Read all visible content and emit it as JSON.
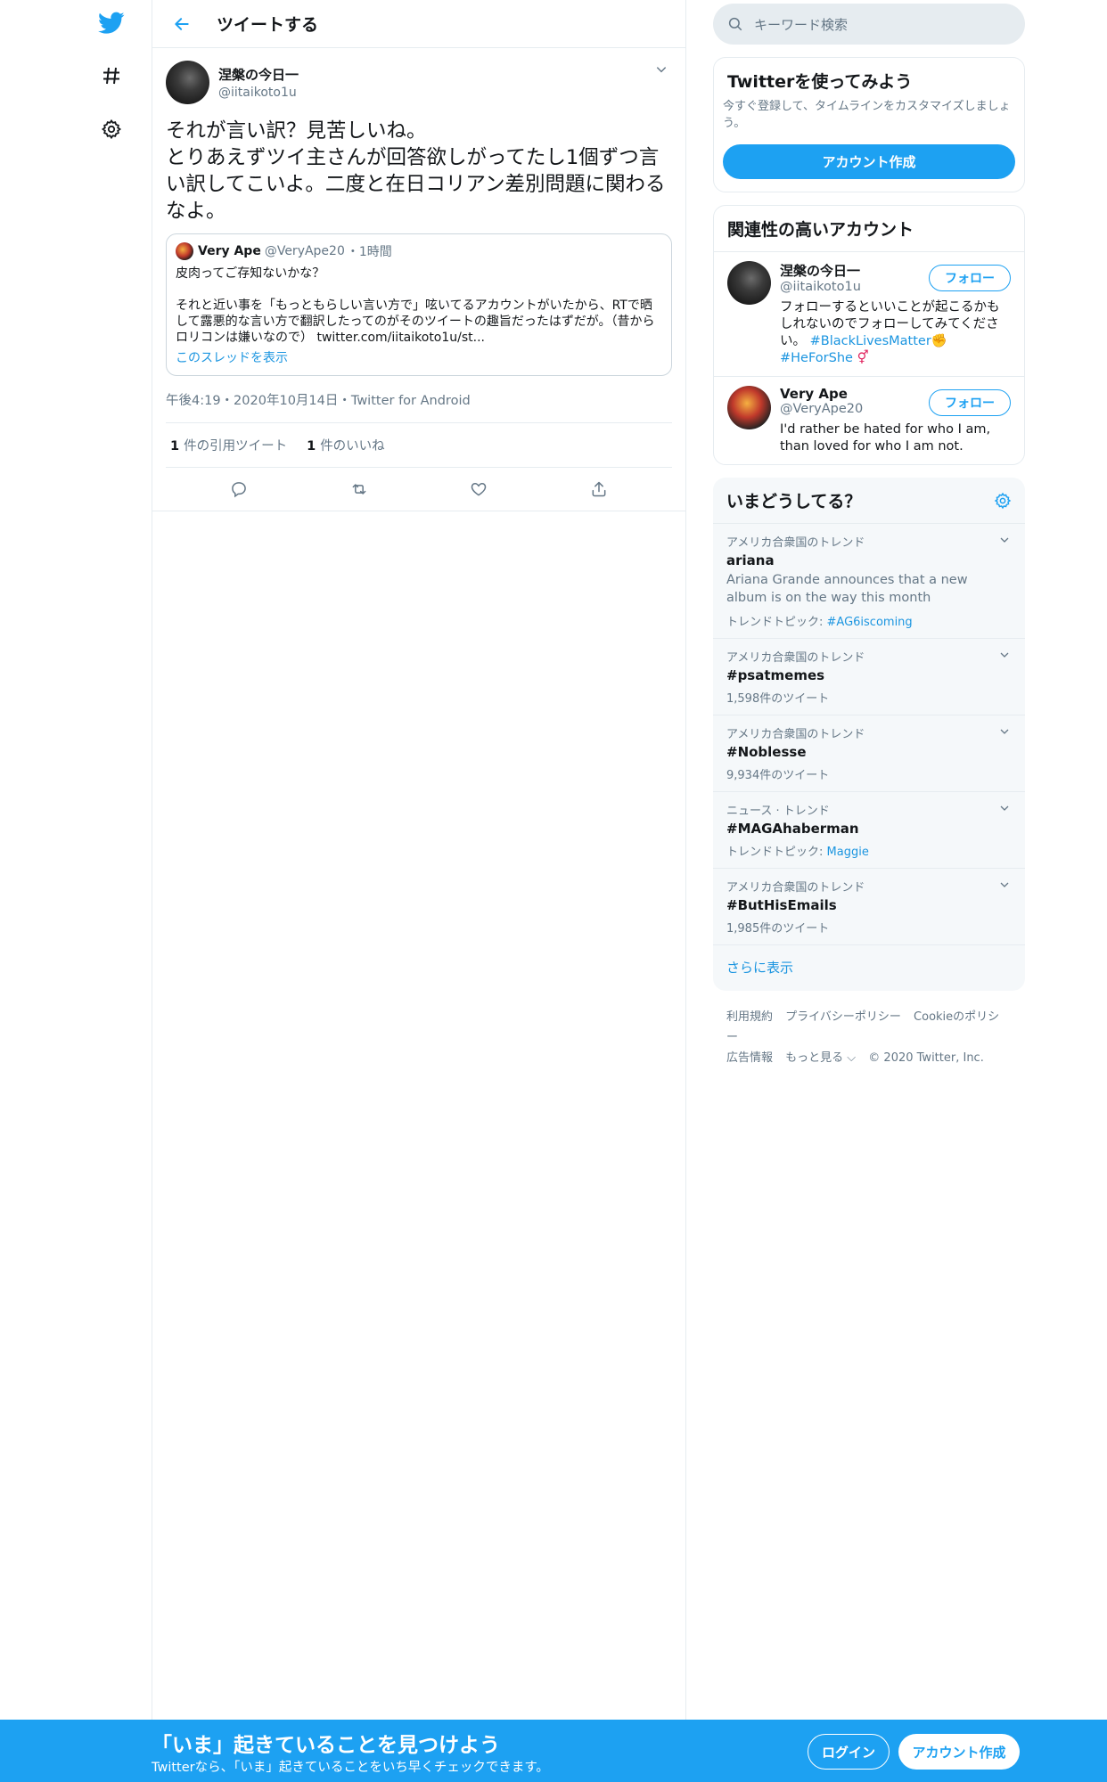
{
  "nav": {
    "icons": [
      "twitter-bird-icon",
      "hashtag-icon",
      "gear-icon"
    ]
  },
  "header": {
    "title": "ツイートする"
  },
  "tweet": {
    "author_name": "涅槃の今日一",
    "author_handle": "@iitaikoto1u",
    "text": "それが言い訳？見苦しいね。\nとりあえずツイ主さんが回答欲しがってたし1個ずつ言い訳してこいよ。二度と在日コリアン差別問題に関わるなよ。",
    "quote": {
      "name": "Very Ape",
      "handle": "@VeryApe20",
      "time": "・1時間",
      "text": "皮肉ってご存知ないかな？\n\nそれと近い事を「もっともらしい言い方で」呟いてるアカウントがいたから、RTで晒して露悪的な言い方で翻訳したってのがそのツイートの趣旨だったはずだが。（昔からロリコンは嫌いなので） twitter.com/iitaikoto1u/st...",
      "thread_link": "このスレッドを表示"
    },
    "meta": "午後4:19・2020年10月14日・Twitter for Android",
    "quote_count": "1",
    "quote_label": "件の引用ツイート",
    "like_count": "1",
    "like_label": "件のいいね"
  },
  "search": {
    "placeholder": "キーワード検索"
  },
  "signup_card": {
    "title": "Twitterを使ってみよう",
    "desc": "今すぐ登録して、タイムラインをカスタマイズしましょう。",
    "button": "アカウント作成"
  },
  "related": {
    "title": "関連性の高いアカウント",
    "follow_label": "フォロー",
    "accounts": [
      {
        "name": "涅槃の今日一",
        "handle": "@iitaikoto1u",
        "bio": "フォローするといいことが起こるかもしれないのでフォローしてみてください。",
        "tag1": "#BlackLivesMatter",
        "tag2": "#HeForShe"
      },
      {
        "name": "Very Ape",
        "handle": "@VeryApe20",
        "bio": "I'd rather be hated for who I am, than loved for who I am not."
      }
    ]
  },
  "trends": {
    "title": "いまどうしてる？",
    "items": [
      {
        "context": "アメリカ合衆国のトレンド",
        "name": "ariana",
        "desc": "Ariana Grande announces that a new album is on the way this month",
        "sub_label": "トレンドトピック: ",
        "sub_link": "#AG6iscoming"
      },
      {
        "context": "アメリカ合衆国のトレンド",
        "name": "#psatmemes",
        "count": "1,598件のツイート"
      },
      {
        "context": "アメリカ合衆国のトレンド",
        "name": "#Noblesse",
        "count": "9,934件のツイート"
      },
      {
        "context": "ニュース · トレンド",
        "name": "#MAGAhaberman",
        "sub_label": "トレンドトピック: ",
        "sub_link": "Maggie"
      },
      {
        "context": "アメリカ合衆国のトレンド",
        "name": "#ButHisEmails",
        "count": "1,985件のツイート"
      }
    ],
    "show_more": "さらに表示"
  },
  "footer": {
    "links": [
      "利用規約",
      "プライバシーポリシー",
      "Cookieのポリシー",
      "広告情報",
      "もっと見る ⌵"
    ],
    "copyright": "© 2020 Twitter, Inc."
  },
  "banner": {
    "title": "「いま」起きていることを見つけよう",
    "subtitle": "Twitterなら、「いま」起きていることをいち早くチェックできます。",
    "login": "ログイン",
    "signup": "アカウント作成"
  },
  "colors": {
    "accent": "#1da1f2",
    "link": "#1b95e0",
    "secondary_text": "#657786",
    "border": "#e6ecf0"
  }
}
